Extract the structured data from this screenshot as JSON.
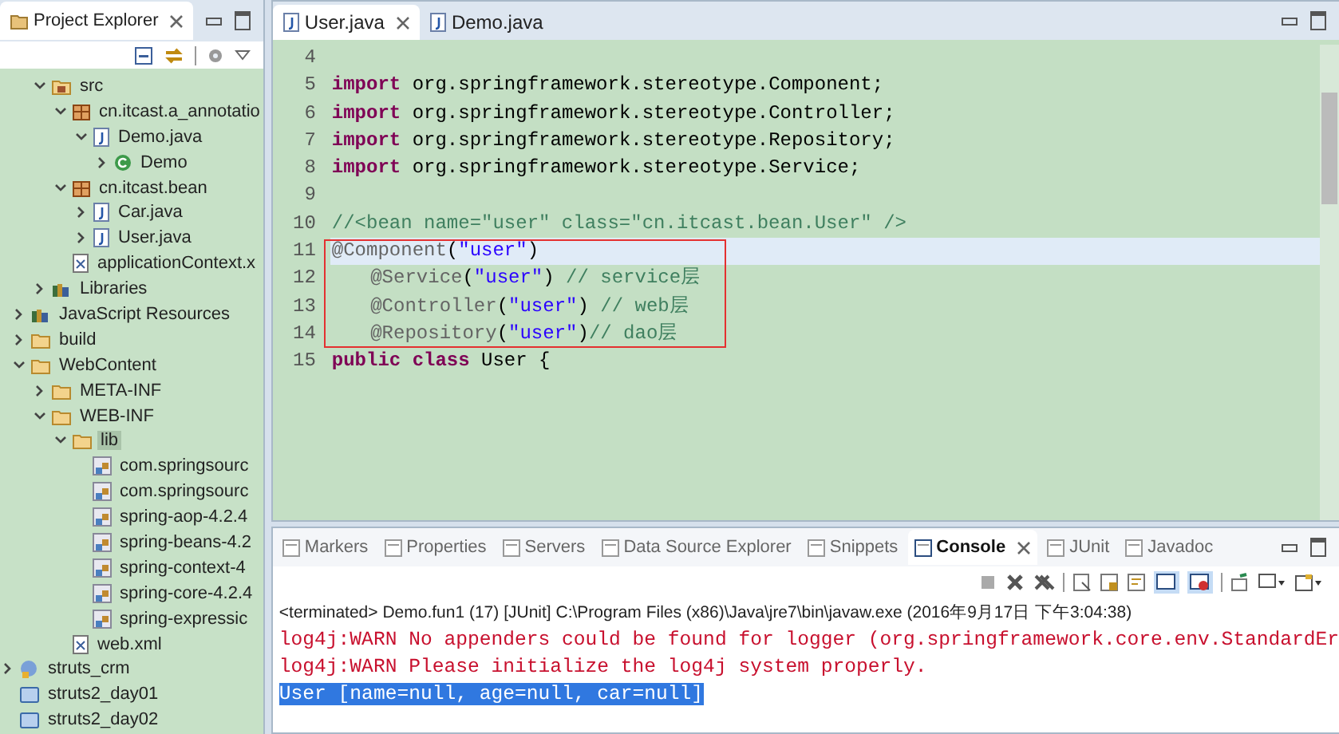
{
  "project_explorer": {
    "title": "Project Explorer",
    "tree": [
      {
        "children": [
          {
            "children": [
              {
                "label": "src",
                "kind": "src",
                "expanded": true,
                "selected": false,
                "children": [
                  {
                    "label": "cn.itcast.a_annotatio",
                    "kind": "package",
                    "expanded": true,
                    "selected": false,
                    "children": [
                      {
                        "label": "Demo.java",
                        "kind": "java",
                        "expanded": true,
                        "selected": false,
                        "children": [
                          {
                            "label": "Demo",
                            "kind": "class",
                            "expanded": false,
                            "selected": false
                          }
                        ]
                      }
                    ]
                  },
                  {
                    "label": "cn.itcast.bean",
                    "kind": "package",
                    "expanded": true,
                    "selected": false,
                    "children": [
                      {
                        "label": "Car.java",
                        "kind": "java",
                        "expanded": false,
                        "selected": false
                      },
                      {
                        "label": "User.java",
                        "kind": "java",
                        "expanded": false,
                        "selected": false
                      }
                    ]
                  },
                  {
                    "label": "applicationContext.x",
                    "kind": "xml",
                    "selected": false
                  }
                ]
              },
              {
                "label": "Libraries",
                "kind": "library",
                "expanded": false,
                "selected": false
              }
            ]
          },
          {
            "label": "JavaScript Resources",
            "kind": "library",
            "expanded": false,
            "selected": false
          },
          {
            "label": "build",
            "kind": "folder",
            "expanded": false,
            "selected": false
          },
          {
            "label": "WebContent",
            "kind": "folder",
            "expanded": true,
            "selected": false,
            "children": [
              {
                "label": "META-INF",
                "kind": "folder",
                "expanded": false,
                "selected": false
              },
              {
                "label": "WEB-INF",
                "kind": "folder",
                "expanded": true,
                "selected": false,
                "children": [
                  {
                    "label": "lib",
                    "kind": "folder",
                    "expanded": true,
                    "selected": true,
                    "children": [
                      {
                        "label": "com.springsourc",
                        "kind": "jar",
                        "selected": false
                      },
                      {
                        "label": "com.springsourc",
                        "kind": "jar",
                        "selected": false
                      },
                      {
                        "label": "spring-aop-4.2.4",
                        "kind": "jar",
                        "selected": false
                      },
                      {
                        "label": "spring-beans-4.2",
                        "kind": "jar",
                        "selected": false
                      },
                      {
                        "label": "spring-context-4",
                        "kind": "jar",
                        "selected": false
                      },
                      {
                        "label": "spring-core-4.2.4",
                        "kind": "jar",
                        "selected": false
                      },
                      {
                        "label": "spring-expressic",
                        "kind": "jar",
                        "selected": false
                      }
                    ]
                  },
                  {
                    "label": "web.xml",
                    "kind": "xml",
                    "selected": false
                  }
                ]
              }
            ]
          }
        ]
      },
      {
        "label": "struts_crm",
        "kind": "project",
        "expanded": false,
        "selected": false
      },
      {
        "label": "struts2_day01",
        "kind": "closed-project",
        "selected": false
      },
      {
        "label": "struts2_day02",
        "kind": "closed-project",
        "selected": false
      }
    ]
  },
  "editor": {
    "tabs": [
      {
        "label": "User.java",
        "selected": true
      },
      {
        "label": "Demo.java",
        "selected": false
      }
    ],
    "lines": [
      {
        "number": "4",
        "current": false
      },
      {
        "number": "5",
        "current": false,
        "tokens": [
          {
            "kind": "keyword",
            "text": "import"
          },
          {
            "kind": "plain",
            "text": " org.springframework.stereotype.Component;"
          }
        ]
      },
      {
        "number": "6",
        "current": false,
        "tokens": [
          {
            "kind": "keyword",
            "text": "import"
          },
          {
            "kind": "plain",
            "text": " org.springframework.stereotype.Controller;"
          }
        ]
      },
      {
        "number": "7",
        "current": false,
        "tokens": [
          {
            "kind": "keyword",
            "text": "import"
          },
          {
            "kind": "plain",
            "text": " org.springframework.stereotype.Repository;"
          }
        ]
      },
      {
        "number": "8",
        "current": false,
        "tokens": [
          {
            "kind": "keyword",
            "text": "import"
          },
          {
            "kind": "plain",
            "text": " org.springframework.stereotype.Service;"
          }
        ]
      },
      {
        "number": "9",
        "current": false
      },
      {
        "number": "10",
        "current": false,
        "tokens": [
          {
            "kind": "comment",
            "text": "//<bean name=\"user\" class=\"cn.itcast.bean.User\" />"
          }
        ]
      },
      {
        "number": "11",
        "current": true,
        "tokens": [
          {
            "kind": "annotation",
            "text": "@Component"
          },
          {
            "kind": "plain",
            "text": "("
          },
          {
            "kind": "string",
            "text": "\"user\""
          },
          {
            "kind": "plain",
            "text": ")"
          }
        ]
      },
      {
        "number": "12",
        "current": false,
        "indented": true,
        "tokens": [
          {
            "kind": "annotation",
            "text": "@Service"
          },
          {
            "kind": "plain",
            "text": "("
          },
          {
            "kind": "string",
            "text": "\"user\""
          },
          {
            "kind": "plain",
            "text": ") "
          },
          {
            "kind": "comment",
            "text": "// service层"
          }
        ]
      },
      {
        "number": "13",
        "current": false,
        "indented": true,
        "tokens": [
          {
            "kind": "annotation",
            "text": "@Controller"
          },
          {
            "kind": "plain",
            "text": "("
          },
          {
            "kind": "string",
            "text": "\"user\""
          },
          {
            "kind": "plain",
            "text": ") "
          },
          {
            "kind": "comment",
            "text": "// web层"
          }
        ]
      },
      {
        "number": "14",
        "current": false,
        "indented": true,
        "tokens": [
          {
            "kind": "annotation",
            "text": "@Repository"
          },
          {
            "kind": "plain",
            "text": "("
          },
          {
            "kind": "string",
            "text": "\"user\""
          },
          {
            "kind": "plain",
            "text": ")"
          },
          {
            "kind": "comment",
            "text": "// dao层"
          }
        ]
      },
      {
        "number": "15",
        "current": false,
        "tokens": [
          {
            "kind": "keyword",
            "text": "public class"
          },
          {
            "kind": "plain",
            "text": " User {"
          }
        ]
      }
    ]
  },
  "console": {
    "tabs": [
      {
        "label": "Markers",
        "selected": false
      },
      {
        "label": "Properties",
        "selected": false
      },
      {
        "label": "Servers",
        "selected": false
      },
      {
        "label": "Data Source Explorer",
        "selected": false
      },
      {
        "label": "Snippets",
        "selected": false
      },
      {
        "label": "Console",
        "selected": true
      },
      {
        "label": "JUnit",
        "selected": false
      },
      {
        "label": "Javadoc",
        "selected": false
      }
    ],
    "status": "<terminated> Demo.fun1 (17) [JUnit] C:\\Program Files (x86)\\Java\\jre7\\bin\\javaw.exe (2016年9月17日 下午3:04:38)",
    "output": [
      {
        "kind": "error",
        "text": "log4j:WARN No appenders could be found for logger (org.springframework.core.env.StandardEr"
      },
      {
        "kind": "error",
        "text": "log4j:WARN Please initialize the log4j system properly."
      },
      {
        "kind": "selected",
        "text": "User [name=null, age=null, car=null]"
      }
    ]
  }
}
